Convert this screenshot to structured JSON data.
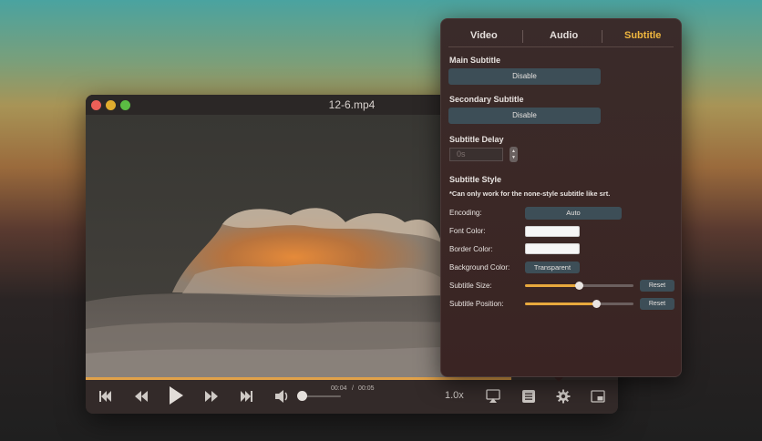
{
  "window": {
    "title": "12-6.mp4"
  },
  "playback": {
    "progress": 0.8,
    "current_time": "00:04",
    "time_separator": "/",
    "total_time": "00:05",
    "volume": 0.0,
    "speed": "1.0x"
  },
  "panel": {
    "tabs": [
      {
        "label": "Video"
      },
      {
        "label": "Audio"
      },
      {
        "label": "Subtitle"
      }
    ],
    "active_tab": "Subtitle",
    "main_subtitle": {
      "label": "Main Subtitle",
      "button": "Disable"
    },
    "secondary_subtitle": {
      "label": "Secondary Subtitle",
      "button": "Disable"
    },
    "delay": {
      "label": "Subtitle Delay",
      "value": "0s"
    },
    "style": {
      "label": "Subtitle Style",
      "note": "*Can only work for the none-style subtitle like srt.",
      "encoding_label": "Encoding:",
      "encoding_value": "Auto",
      "font_color_label": "Font Color:",
      "font_color": "#f6f6f6",
      "border_color_label": "Border Color:",
      "border_color": "#f6f6f6",
      "background_color_label": "Background Color:",
      "background_color_value": "Transparent",
      "size_label": "Subtitle Size:",
      "size_value": 0.5,
      "size_reset": "Reset",
      "position_label": "Subtitle Position:",
      "position_value": 0.66,
      "position_reset": "Reset"
    }
  },
  "colors": {
    "accent": "#f0b73f",
    "button_bg": "#3d4e57"
  }
}
